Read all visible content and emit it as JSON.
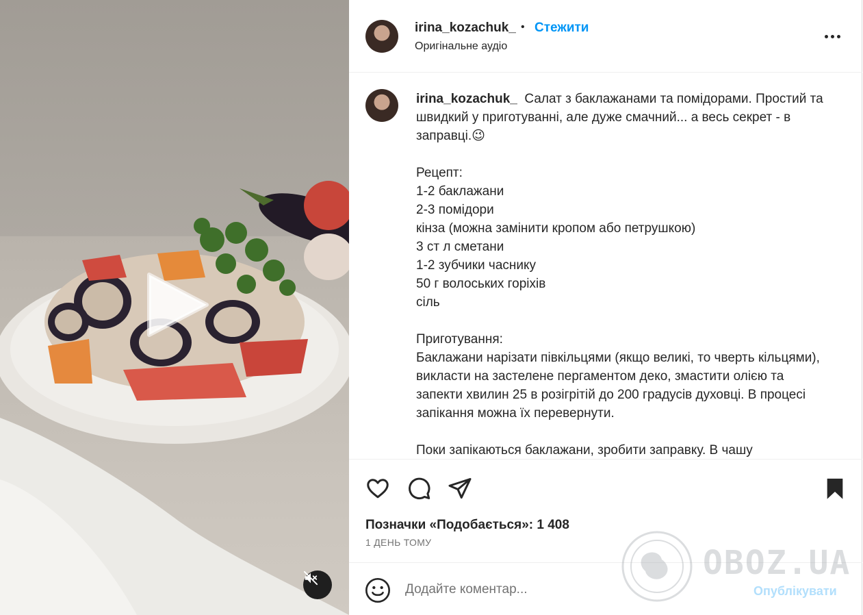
{
  "post": {
    "username": "irina_kozachuk_",
    "follow_label": "Стежити",
    "audio_label": "Оригінальне аудіо",
    "caption": "Салат з баклажанами та помідорами. Простий та швидкий у приготуванні, але дуже смачний... а весь секрет - в заправці.😉\n\nРецепт:\n1-2 баклажани\n2-3 помідори\nкінза (можна замінити кропом або петрушкою)\n3 ст л сметани\n1-2 зубчики часнику\n50 г волоських горіхів\nсіль\n\nПриготування:\nБаклажани нарізати півкільцями (якщо великі, то чверть кільцями), викласти на застелене пергаментом деко, змастити олією та запекти хвилин 25 в розігрітій до 200 градусів духовці. В процесі запікання можна їх перевернути.\n\nПоки запікаються баклажани, зробити заправку. В чашу",
    "likes_label": "Позначки «Подобається»: 1 408",
    "time_label": "1 ДЕНЬ ТОМУ"
  },
  "comment": {
    "placeholder": "Додайте коментар...",
    "publish_label": "Опублікувати"
  },
  "watermark": {
    "text": "OBOZ.UA"
  },
  "icons": {
    "play": "play-icon",
    "mute": "speaker-muted-icon",
    "more": "more-horizontal-icon",
    "like": "heart-icon",
    "comment": "speech-bubble-icon",
    "share": "paper-plane-icon",
    "save": "bookmark-filled-icon",
    "emoji": "smiley-icon"
  },
  "colors": {
    "accent": "#0095f6",
    "publish_disabled": "#b2dffc",
    "text": "#262626",
    "secondary_text": "#737373"
  }
}
